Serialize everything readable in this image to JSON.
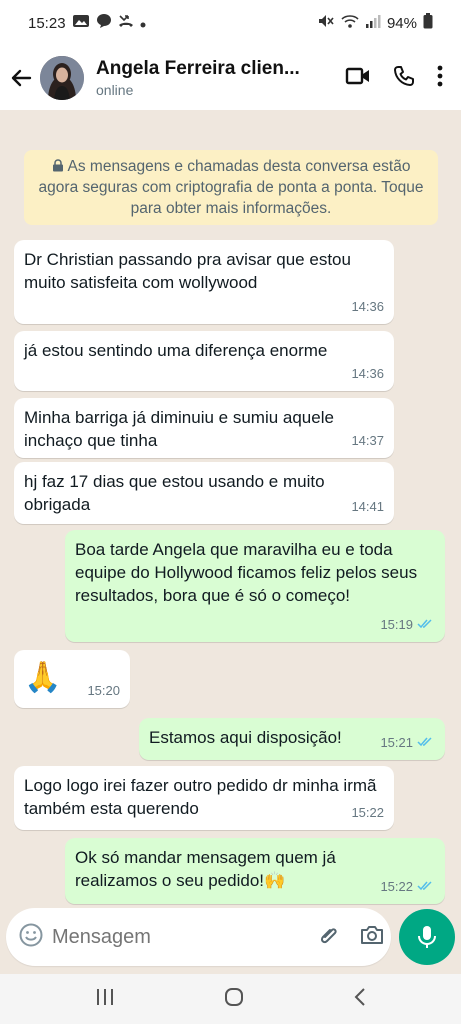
{
  "status_bar": {
    "time": "15:23",
    "battery": "94%",
    "left_icons": [
      "gallery-icon",
      "message-icon",
      "missed-call-icon",
      "dot-icon"
    ],
    "right_icons": [
      "mute-icon",
      "wifi-icon",
      "signal-icon",
      "battery-icon"
    ]
  },
  "header": {
    "contact_name": "Angela Ferreira clien...",
    "contact_status": "online",
    "actions": [
      "video-call-icon",
      "phone-call-icon",
      "more-options-icon"
    ]
  },
  "encryption_notice": "As mensagens e chamadas desta conversa estão agora seguras com criptografia de ponta a ponta. Toque para obter mais informações.",
  "messages": [
    {
      "direction": "in",
      "text": "Dr Christian passando pra avisar que estou muito satisfeita com wollywood",
      "time": "14:36"
    },
    {
      "direction": "in",
      "text": "já estou sentindo uma diferença enorme",
      "time": "14:36"
    },
    {
      "direction": "in",
      "text": "Minha barriga já diminuiu e sumiu aquele inchaço que tinha",
      "time": "14:37"
    },
    {
      "direction": "in",
      "text": "hj faz 17 dias que estou usando e muito obrigada",
      "time": "14:41"
    },
    {
      "direction": "out",
      "text": "Boa tarde Angela que maravilha eu e toda equipe do Hollywood ficamos feliz pelos seus resultados, bora que é só o começo!",
      "time": "15:19",
      "read": true
    },
    {
      "direction": "in",
      "text": "🙏",
      "time": "15:20"
    },
    {
      "direction": "out",
      "text": "Estamos aqui disposição!",
      "time": "15:21",
      "read": true
    },
    {
      "direction": "in",
      "text": "Logo logo irei fazer outro pedido dr minha irmã também esta querendo",
      "time": "15:22"
    },
    {
      "direction": "out",
      "text": "Ok só mandar mensagem quem já realizamos o seu pedido!🙌",
      "time": "15:22",
      "read": true
    }
  ],
  "composer": {
    "placeholder": "Mensagem"
  },
  "colors": {
    "accent": "#00a884",
    "outgoing_bubble": "#d9fdd3",
    "incoming_bubble": "#ffffff",
    "chat_background": "#efe7de",
    "encryption_banner": "#fcf0c5",
    "read_ticks": "#53bdeb"
  }
}
